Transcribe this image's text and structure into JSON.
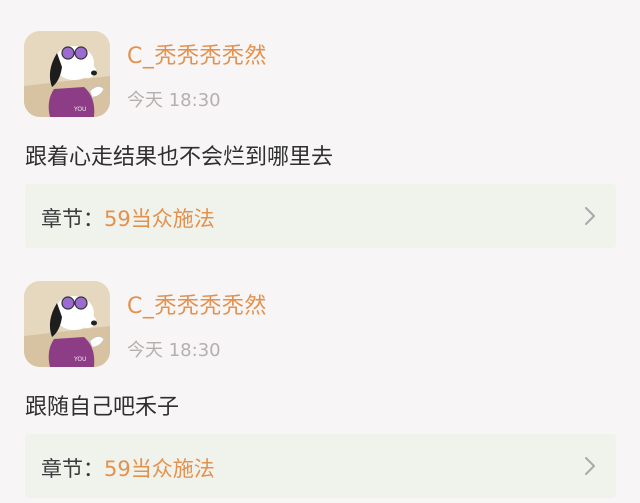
{
  "comments": [
    {
      "username": "C_秃秃秃秃然",
      "timestamp": "今天 18:30",
      "text": "跟着心走结果也不会烂到哪里去",
      "chapter_label": "章节：",
      "chapter_title": "59当众施法",
      "avatar_icon": "snoopy-avatar-icon"
    },
    {
      "username": "C_秃秃秃秃然",
      "timestamp": "今天 18:30",
      "text": "跟随自己吧禾子",
      "chapter_label": "章节：",
      "chapter_title": "59当众施法",
      "avatar_icon": "snoopy-avatar-icon"
    }
  ],
  "colors": {
    "accent": "#e3914f",
    "muted": "#b4b0ae",
    "card_bg": "#f0f2ec",
    "page_bg": "#f7f5f5"
  }
}
